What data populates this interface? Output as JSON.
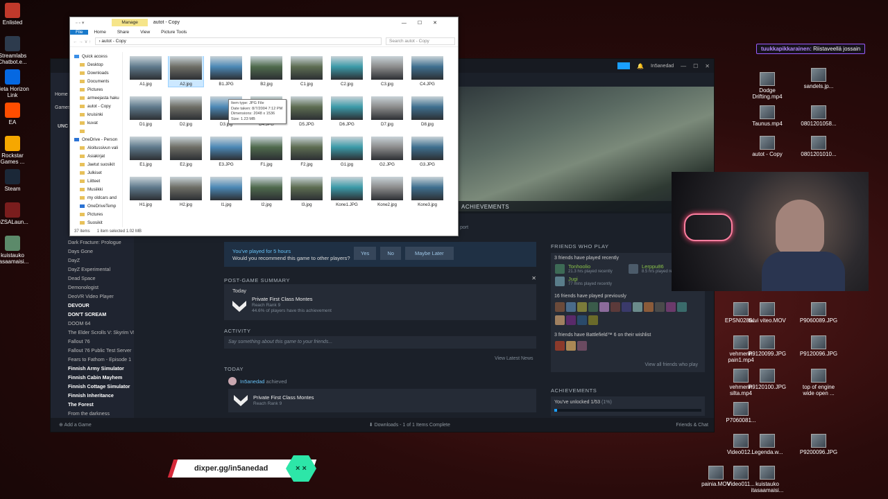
{
  "desktop": {
    "left_icons": [
      "Enlisted",
      "Streamlabs Chatbot.e...",
      "Meta Horizon Link",
      "EA",
      "Rockstar Games ...",
      "Steam",
      "DZSALaun...",
      "kuistauko itasaamaisi..."
    ],
    "right_icons": [
      "Dodge Drifting.mp4",
      "sandels.jp...",
      "Taunus.mp4",
      "0801201058...",
      "autot - Copy",
      "0801201010...",
      "EPSN0285...",
      "talvi viteo.MOV",
      "P9060089.JPG",
      "vehmerin pain1.mp4",
      "P9120099.JPG",
      "P9120096.JPG",
      "vehmerin silta.mp4",
      "P9120100.JPG",
      "top of engine wide open ...",
      "P7060081...",
      "Video012...",
      "Legenda.w...",
      "P9200096.JPG",
      "painia.MOV",
      "Video011...",
      "kuistauko itasaamaisi..."
    ]
  },
  "explorer": {
    "title": "autot - Copy",
    "manage_tab": "Manage",
    "picture_tools": "Picture Tools",
    "ribbon_tabs": [
      "File",
      "Home",
      "Share",
      "View"
    ],
    "breadcrumb": "autot - Copy",
    "search_placeholder": "Search autot - Copy",
    "nav": [
      {
        "label": "Quick access",
        "level": 0
      },
      {
        "label": "Desktop",
        "level": 1
      },
      {
        "label": "Downloads",
        "level": 1
      },
      {
        "label": "Documents",
        "level": 1
      },
      {
        "label": "Pictures",
        "level": 1
      },
      {
        "label": "armeejasta haku",
        "level": 1
      },
      {
        "label": "autot - Copy",
        "level": 1
      },
      {
        "label": "kruisinki",
        "level": 1
      },
      {
        "label": "kuvat",
        "level": 1
      },
      {
        "label": "",
        "level": 1
      },
      {
        "label": "OneDrive - Person",
        "level": 0
      },
      {
        "label": "Aloitussivun vali",
        "level": 1
      },
      {
        "label": "Asiakirjat",
        "level": 1
      },
      {
        "label": "Jaetut suosikit",
        "level": 1
      },
      {
        "label": "Julkiset",
        "level": 1
      },
      {
        "label": "Liitteet",
        "level": 1
      },
      {
        "label": "Musiikki",
        "level": 1
      },
      {
        "label": "my oldcars and",
        "level": 1
      },
      {
        "label": "OneDriveTemp",
        "level": 1
      },
      {
        "label": "Pictures",
        "level": 1
      },
      {
        "label": "Suosikit",
        "level": 1
      },
      {
        "label": "Tyopoyta",
        "level": 1
      }
    ],
    "files": [
      "A1.jpg",
      "A2.jpg",
      "B1.JPG",
      "B2.jpg",
      "C1.jpg",
      "C2.jpg",
      "C3.jpg",
      "C4.JPG",
      "D1.jpg",
      "D2.jpg",
      "D3.jpg",
      "D4.JPG",
      "D5.JPG",
      "D6.JPG",
      "D7.jpg",
      "D8.jpg",
      "E1.jpg",
      "E2.jpg",
      "E3.JPG",
      "F1.jpg",
      "F2.jpg",
      "G1.jpg",
      "G2.JPG",
      "G3.JPG",
      "H1.jpg",
      "H2.jpg",
      "I1.jpg",
      "I2.jpg",
      "I3.jpg",
      "Kone1.JPG",
      "Kone2.jpg",
      "Kone3.jpg"
    ],
    "selected_index": 1,
    "tooltip": {
      "type": "Item type: JPG File",
      "date": "Date taken: 8/7/2004 7:12 PM",
      "dims": "Dimensions: 2048 x 1536",
      "size": "Size: 1.23 MB"
    },
    "status": {
      "count": "37 items",
      "selected": "1 item selected  1.02 MB"
    }
  },
  "steam": {
    "account": "In5anedad",
    "sidebar_header": "UNC",
    "nav_home": "Home",
    "nav_games": "Games",
    "games": [
      {
        "name": "Dark Fracture: Prologue",
        "bold": false
      },
      {
        "name": "Days Gone",
        "bold": false
      },
      {
        "name": "DayZ",
        "bold": false
      },
      {
        "name": "DayZ Experimental",
        "bold": false
      },
      {
        "name": "Dead Space",
        "bold": false
      },
      {
        "name": "Demonologist",
        "bold": false
      },
      {
        "name": "DeoVR Video Player",
        "bold": false
      },
      {
        "name": "DEVOUR",
        "bold": true
      },
      {
        "name": "DON'T SCREAM",
        "bold": true
      },
      {
        "name": "DOOM 64",
        "bold": false
      },
      {
        "name": "The Elder Scrolls V: Skyrim VR",
        "bold": false
      },
      {
        "name": "Fallout 76",
        "bold": false
      },
      {
        "name": "Fallout 76 Public Test Server",
        "bold": false
      },
      {
        "name": "Fears to Fathom - Episode 1",
        "bold": false
      },
      {
        "name": "Finnish Army Simulator",
        "bold": true
      },
      {
        "name": "Finnish Cabin Mayhem",
        "bold": true
      },
      {
        "name": "Finnish Cottage Simulator",
        "bold": true
      },
      {
        "name": "Finnish Inheritance",
        "bold": true
      },
      {
        "name": "The Forest",
        "bold": true
      },
      {
        "name": "From the darkness",
        "bold": false
      }
    ],
    "achievements_label": "ACHIEVEMENTS",
    "support_label": "port",
    "recommend": {
      "played": "You've played for 5 hours",
      "question": "Would you recommend this game to other players?",
      "yes": "Yes",
      "no": "No",
      "maybe": "Maybe Later"
    },
    "post_game": {
      "header": "POST-GAME SUMMARY",
      "today": "Today",
      "ach_name": "Private First Class Montes",
      "ach_sub": "Reach Rank 9",
      "ach_pct": "44.6% of players have this achievement"
    },
    "activity": {
      "header": "ACTIVITY",
      "placeholder": "Say something about this game to your friends...",
      "view_news": "View Latest News"
    },
    "today_feed": {
      "header": "TODAY",
      "user": "In5anedad",
      "verb": "achieved",
      "ach_name": "Private First Class Montes",
      "ach_sub": "Reach Rank 9"
    },
    "friends": {
      "header": "FRIENDS WHO PLAY",
      "recent": "3 friends have played recently",
      "f1_name": "Tonhoolio",
      "f1_sub": "21.3 hrs played recently",
      "f2_name": "Jugi",
      "f2_sub": "77 mins played recently",
      "f3_name": "Lerppu86",
      "f3_sub": "8.5 hrs played recently",
      "previously": "16 friends have played previously",
      "wishlist": "3 friends have Battlefield™ 6 on their wishlist",
      "view_all": "View all friends who play"
    },
    "achievements_box": {
      "header": "ACHIEVEMENTS",
      "unlocked": "You've unlocked 1/53",
      "pct": "(1%)",
      "progress_fraction": 0.019
    },
    "bottom": {
      "add_game": "Add a Game",
      "downloads": "Downloads - 1 of 1 Items Complete",
      "friends_chat": "Friends & Chat"
    }
  },
  "overlay": {
    "chat_user": "tuukkapikkarainen:",
    "chat_text": "Riistaveellä jossain",
    "dixper": "dixper.gg/in5anedad"
  },
  "colors": {
    "steam_accent": "#67c1f5",
    "dixper_green": "#2de6a8",
    "dixper_red": "#d62a3a"
  }
}
